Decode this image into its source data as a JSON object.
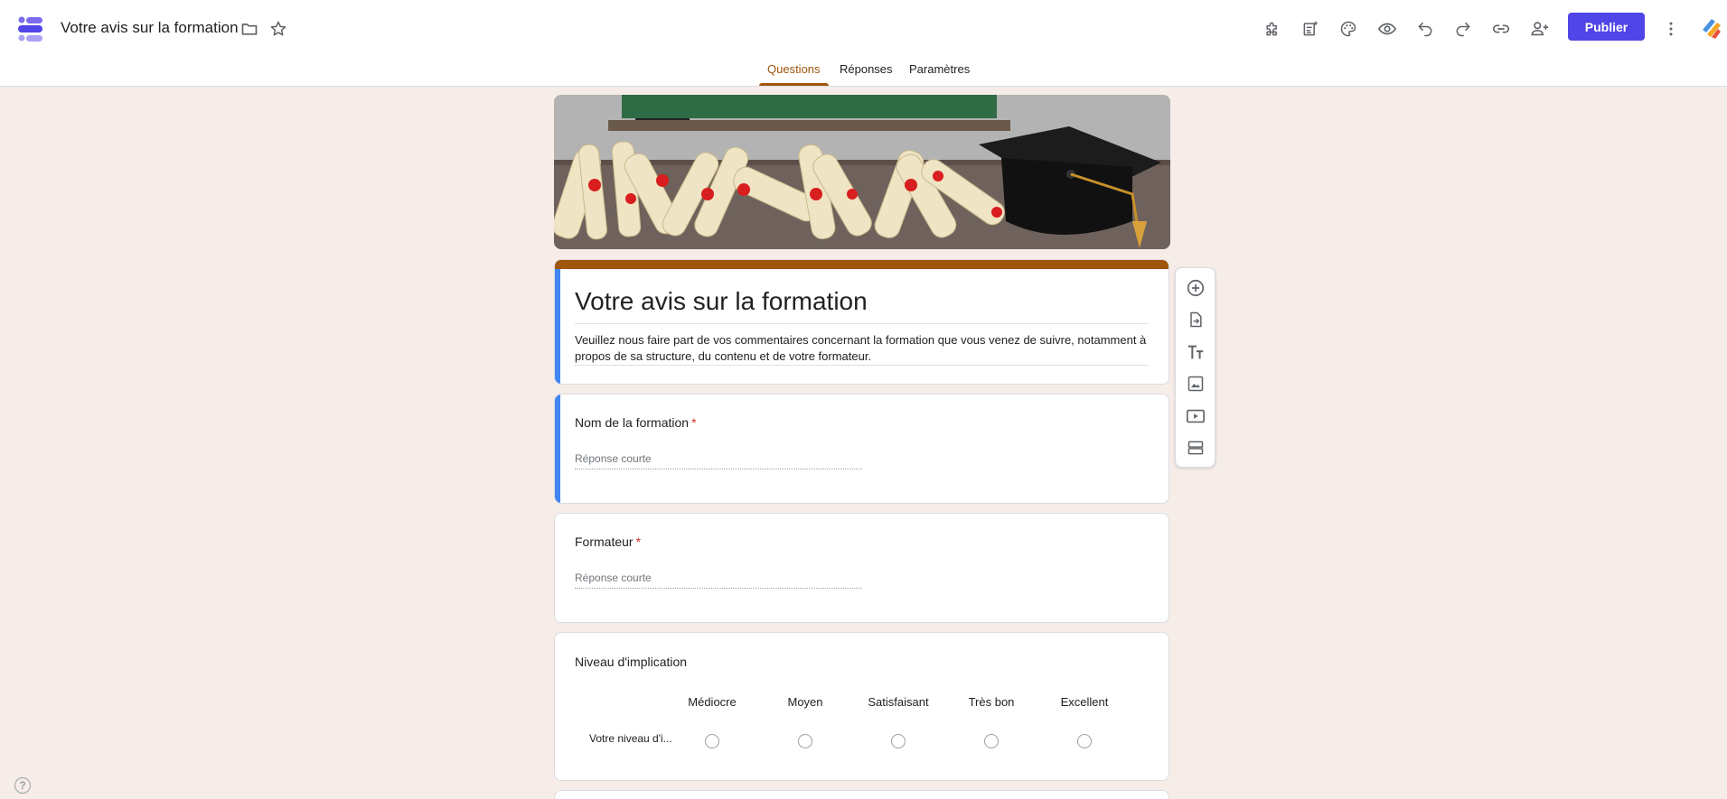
{
  "header": {
    "title": "Votre avis sur la formation",
    "publish_label": "Publier",
    "icons": [
      "folder-icon",
      "star-icon",
      "addons-icon",
      "customize-theme-icon",
      "palette-icon",
      "preview-icon",
      "undo-icon",
      "redo-icon",
      "link-icon",
      "add-collaborator-icon",
      "more-vert-icon"
    ]
  },
  "tabs": [
    {
      "label": "Questions",
      "active": true
    },
    {
      "label": "Réponses",
      "active": false
    },
    {
      "label": "Paramètres",
      "active": false
    }
  ],
  "form": {
    "title": "Votre avis sur la formation",
    "description": "Veuillez nous faire part de vos commentaires concernant la formation que vous venez de suivre, notamment à propos de sa structure, du contenu et de votre formateur.",
    "questions": [
      {
        "title": "Nom de la formation",
        "required": true,
        "required_mark": "*",
        "placeholder": "Réponse courte"
      },
      {
        "title": "Formateur",
        "required": true,
        "required_mark": "*",
        "placeholder": "Réponse courte"
      },
      {
        "title": "Niveau d'implication",
        "columns": [
          "Médiocre",
          "Moyen",
          "Satisfaisant",
          "Très bon",
          "Excellent"
        ],
        "rows": [
          "Votre niveau d'i..."
        ]
      }
    ]
  },
  "floating_toolbar": [
    "add-question-icon",
    "import-questions-icon",
    "add-title-icon",
    "add-image-icon",
    "add-video-icon",
    "add-section-icon"
  ],
  "help_label": "?",
  "colors": {
    "accent": "#a0550c",
    "publish": "#5045e8",
    "selected_card": "#4285f4",
    "background": "#f6ede8",
    "required": "#d93025"
  }
}
